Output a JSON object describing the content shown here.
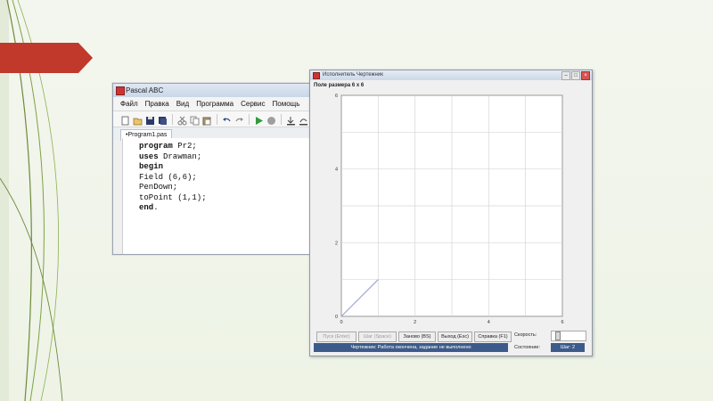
{
  "colors": {
    "banner": "#c0392b",
    "status_bar": "#3c5b8a",
    "plot_line": "#9aa7d6",
    "grid": "#d6d6d6"
  },
  "ide": {
    "title": "Pascal ABC",
    "menu": [
      "Файл",
      "Правка",
      "Вид",
      "Программа",
      "Сервис",
      "Помощь"
    ],
    "tab_label": "•Program1.pas",
    "code_lines": [
      {
        "kw": "program",
        "rest": " Pr2;"
      },
      {
        "kw": "uses",
        "rest": " Drawman;"
      },
      {
        "kw": "begin",
        "rest": ""
      },
      {
        "kw": "",
        "rest": "Field (6,6);"
      },
      {
        "kw": "",
        "rest": "PenDown;"
      },
      {
        "kw": "",
        "rest": "toPoint (1,1);"
      },
      {
        "kw": "end",
        "rest": "."
      }
    ]
  },
  "drawman": {
    "title": "Исполнитель Чертежник",
    "field_label": "Поле размера 6 x 6",
    "buttons": {
      "start": "Пуск (Enter)",
      "step": "Шаг (Space)",
      "restart": "Заново (BS)",
      "exit": "Выход (Esc)",
      "help": "Справка (F1)"
    },
    "speed_label": "Скорость:",
    "state_label": "Состояние:",
    "status_text": "Чертежник: Работа окончена, задание не выполнено",
    "step_text": "Шаг: 2"
  },
  "chart_data": {
    "type": "line",
    "xlim": [
      0,
      6
    ],
    "ylim": [
      0,
      6
    ],
    "grid": true,
    "x_ticks": [
      "0",
      "2",
      "4",
      "6"
    ],
    "y_ticks": [
      "0",
      "2",
      "4",
      "6"
    ],
    "segments": [
      {
        "x": [
          0,
          1
        ],
        "y": [
          0,
          1
        ]
      }
    ]
  }
}
